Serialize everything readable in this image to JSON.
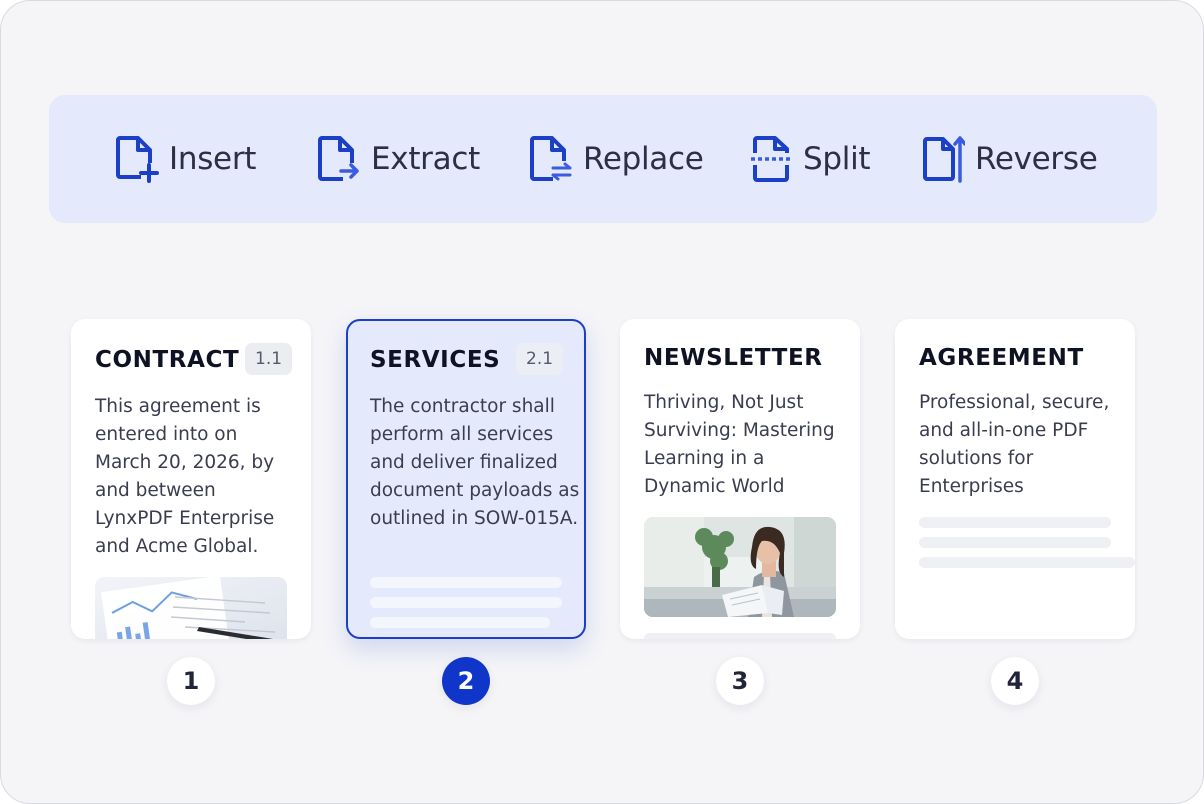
{
  "colors": {
    "accent": "#1c3fc7",
    "toolbar_bg": "#e4e9fb",
    "selected_card_bg": "#e4e9fb",
    "active_number_bg": "#0f36c8"
  },
  "toolbar": {
    "tools": [
      {
        "label": "Insert",
        "icon": "file-insert-icon"
      },
      {
        "label": "Extract",
        "icon": "file-extract-icon"
      },
      {
        "label": "Replace",
        "icon": "file-replace-icon"
      },
      {
        "label": "Split",
        "icon": "file-split-icon"
      },
      {
        "label": "Reverse",
        "icon": "file-reverse-icon"
      }
    ]
  },
  "pages": [
    {
      "number": "1",
      "title": "CONTRACT",
      "badge": "1.1",
      "body": "This agreement is entered into on March 20, 2026, by and between LynxPDF Enterprise and Acme Global.",
      "image": "document-chart-photo",
      "selected": false
    },
    {
      "number": "2",
      "title": "SERVICES",
      "badge": "2.1",
      "body": "The contractor shall perform all services and deliver finalized document payloads as outlined in SOW-015A.",
      "selected": true
    },
    {
      "number": "3",
      "title": "NEWSLETTER",
      "body": "Thriving, Not Just Surviving: Mastering Learning in a Dynamic World",
      "image": "woman-reading-photo",
      "selected": false
    },
    {
      "number": "4",
      "title": "AGREEMENT",
      "body": "Professional, secure, and all-in-one PDF solutions for Enterprises",
      "selected": false
    }
  ]
}
